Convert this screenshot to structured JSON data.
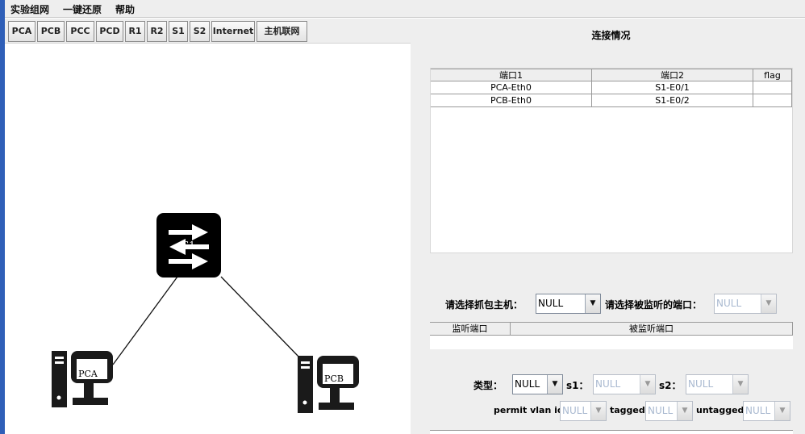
{
  "menu": [
    {
      "label": "实验组网"
    },
    {
      "label": "一键还原"
    },
    {
      "label": "帮助"
    }
  ],
  "toolbar": [
    {
      "label": "PCA"
    },
    {
      "label": "PCB"
    },
    {
      "label": "PCC"
    },
    {
      "label": "PCD"
    },
    {
      "label": "R1"
    },
    {
      "label": "R2"
    },
    {
      "label": "S1"
    },
    {
      "label": "S2"
    },
    {
      "label": "Internet"
    },
    {
      "label": "主机联网"
    }
  ],
  "topology": {
    "switch": {
      "label": "S1",
      "icon": "switch-icon"
    },
    "pcs": [
      {
        "label": "PCA",
        "icon": "pc-icon"
      },
      {
        "label": "PCB",
        "icon": "pc-icon"
      }
    ]
  },
  "right_panel": {
    "title": "连接情况",
    "connections": {
      "columns": [
        "端口1",
        "端口2",
        "flag"
      ],
      "rows": [
        [
          "PCA-Eth0",
          "S1-E0/1",
          ""
        ],
        [
          "PCB-Eth0",
          "S1-E0/2",
          ""
        ]
      ]
    },
    "capture": {
      "host_label": "请选择抓包主机：",
      "host_value": "NULL",
      "port_label": "请选择被监听的端口：",
      "port_value": "NULL"
    },
    "monitor": {
      "columns": [
        "监听端口",
        "被监听端口"
      ]
    },
    "vlan": {
      "type_label": "类型：",
      "type_value": "NULL",
      "s1_label": "s1：",
      "s1_value": "NULL",
      "s2_label": "s2：",
      "s2_value": "NULL",
      "permit_label": "permit vlan id",
      "permit_value": "NULL",
      "tagged_label": "tagged",
      "tagged_value": "NULL",
      "untagged_label": "untagged",
      "untagged_value": "NULL"
    }
  },
  "colors": {
    "window_edge": "#2f5fb8",
    "panel_bg": "#eeeeee",
    "disabled_text": "#a9b9d0"
  }
}
